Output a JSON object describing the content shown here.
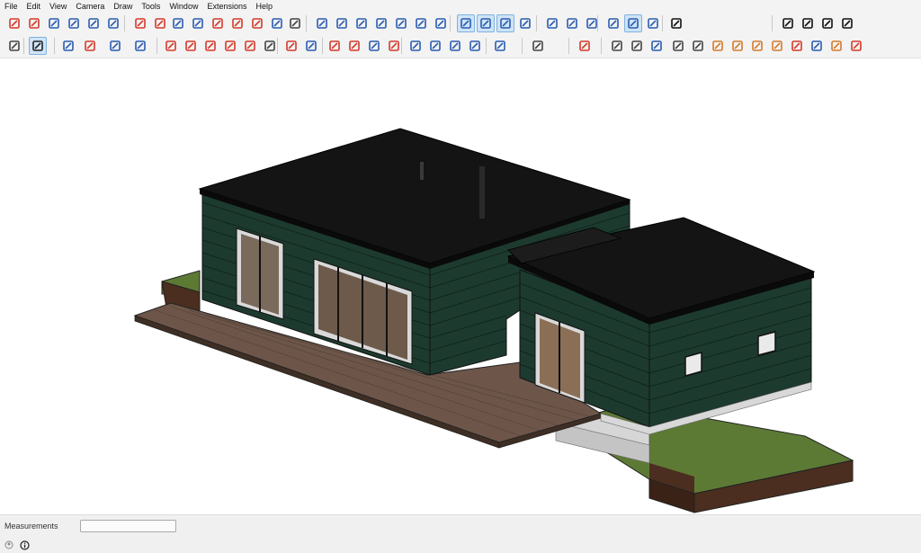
{
  "menu": [
    "File",
    "Edit",
    "View",
    "Camera",
    "Draw",
    "Tools",
    "Window",
    "Extensions",
    "Help"
  ],
  "toolbar_row1": [
    {
      "name": "section-plane-icon",
      "color": "#d43a2a"
    },
    {
      "name": "solid-tools-icon",
      "color": "#d43a2a"
    },
    {
      "name": "follow-me-icon",
      "color": "#2a5db0"
    },
    {
      "name": "text-icon",
      "color": "#2a5db0"
    },
    {
      "name": "axes-icon",
      "color": "#2a5db0"
    },
    {
      "name": "3d-text-icon",
      "color": "#2a5db0"
    },
    {
      "name": "orbit-icon",
      "color": "#d43a2a"
    },
    {
      "name": "pan-icon",
      "color": "#d43a2a"
    },
    {
      "name": "zoom-icon",
      "color": "#2a5db0"
    },
    {
      "name": "zoom-window-icon",
      "color": "#2a5db0"
    },
    {
      "name": "zoom-extents-icon",
      "color": "#d43a2a"
    },
    {
      "name": "previous-view-icon",
      "color": "#d43a2a"
    },
    {
      "name": "position-camera-icon",
      "color": "#d43a2a"
    },
    {
      "name": "look-around-icon",
      "color": "#2a5db0"
    },
    {
      "name": "walk-icon",
      "color": "#444444"
    },
    {
      "name": "iso-view-icon",
      "color": "#2a5db0"
    },
    {
      "name": "top-view-icon",
      "color": "#2a5db0"
    },
    {
      "name": "front-view-icon",
      "color": "#2a5db0"
    },
    {
      "name": "right-view-icon",
      "color": "#2a5db0"
    },
    {
      "name": "back-view-icon",
      "color": "#2a5db0"
    },
    {
      "name": "left-view-icon",
      "color": "#2a5db0"
    },
    {
      "name": "xray-icon",
      "color": "#2a5db0"
    },
    {
      "name": "back-edges-icon",
      "color": "#2a5db0",
      "active": true
    },
    {
      "name": "wireframe-icon",
      "color": "#2a5db0",
      "active": true
    },
    {
      "name": "hidden-line-icon",
      "color": "#2a5db0",
      "active": true
    },
    {
      "name": "shaded-icon",
      "color": "#2a5db0"
    },
    {
      "name": "shaded-textures-icon",
      "color": "#2a5db0"
    },
    {
      "name": "monochrome-icon",
      "color": "#2a5db0"
    },
    {
      "name": "display-edges-icon",
      "color": "#2a5db0"
    },
    {
      "name": "profiles-icon",
      "color": "#2a5db0"
    },
    {
      "name": "depth-cue-icon",
      "color": "#2a5db0",
      "active": true
    },
    {
      "name": "extensions-icon",
      "color": "#2a5db0"
    },
    {
      "name": "refresh-icon",
      "color": "#111111"
    },
    {
      "name": "sync-icon",
      "color": "#111111"
    },
    {
      "name": "plugin-icon",
      "color": "#111111"
    },
    {
      "name": "export-icon",
      "color": "#111111"
    },
    {
      "name": "report-icon",
      "color": "#111111"
    }
  ],
  "toolbar_row2": [
    {
      "name": "search-icon",
      "color": "#444444"
    },
    {
      "name": "select-icon",
      "color": "#222222",
      "active": true
    },
    {
      "name": "eraser-icon",
      "color": "#2a5db0"
    },
    {
      "name": "line-icon",
      "color": "#d43a2a"
    },
    {
      "name": "arc-icon",
      "color": "#2a5db0"
    },
    {
      "name": "rectangle-icon",
      "color": "#2a5db0"
    },
    {
      "name": "push-pull-icon",
      "color": "#d43a2a"
    },
    {
      "name": "offset-icon",
      "color": "#d43a2a"
    },
    {
      "name": "move-icon",
      "color": "#d43a2a"
    },
    {
      "name": "rotate-icon",
      "color": "#d43a2a"
    },
    {
      "name": "scale-icon",
      "color": "#d43a2a"
    },
    {
      "name": "tape-measure-icon",
      "color": "#444444"
    },
    {
      "name": "paint-bucket-icon",
      "color": "#d43a2a"
    },
    {
      "name": "component-icon",
      "color": "#2a5db0"
    },
    {
      "name": "orbit-2-icon",
      "color": "#d43a2a"
    },
    {
      "name": "pan-2-icon",
      "color": "#d43a2a"
    },
    {
      "name": "zoom-2-icon",
      "color": "#2a5db0"
    },
    {
      "name": "zoom-extents-2-icon",
      "color": "#d43a2a"
    },
    {
      "name": "sandbox-icon",
      "color": "#2a5db0"
    },
    {
      "name": "smoove-icon",
      "color": "#2a5db0"
    },
    {
      "name": "stamp-icon",
      "color": "#2a5db0"
    },
    {
      "name": "drape-icon",
      "color": "#2a5db0"
    },
    {
      "name": "warehouse-icon",
      "color": "#2a5db0"
    },
    {
      "name": "new-file-icon",
      "color": "#444444"
    },
    {
      "name": "layout-icon",
      "color": "#d43a2a"
    },
    {
      "name": "pencil-icon",
      "color": "#444444"
    },
    {
      "name": "dimension-icon",
      "color": "#444444"
    },
    {
      "name": "extrude-icon",
      "color": "#2a5db0"
    },
    {
      "name": "follow-path-icon",
      "color": "#444444"
    },
    {
      "name": "array-icon",
      "color": "#444444"
    },
    {
      "name": "box-icon",
      "color": "#d47a2a"
    },
    {
      "name": "loft-icon",
      "color": "#d47a2a"
    },
    {
      "name": "fillet-icon",
      "color": "#d47a2a"
    },
    {
      "name": "bend-icon",
      "color": "#d47a2a"
    },
    {
      "name": "split-icon",
      "color": "#d43a2a"
    },
    {
      "name": "twist-icon",
      "color": "#2a5db0"
    },
    {
      "name": "frame-icon",
      "color": "#d47a2a"
    },
    {
      "name": "frame-pin-icon",
      "color": "#d43a2a"
    }
  ],
  "status": {
    "measurements_label": "Measurements",
    "measurements_value": ""
  },
  "colors": {
    "siding": "#1d3a2f",
    "roof": "#141414",
    "deck": "#6a5448",
    "grass": "#5d7a35",
    "soil": "#4b2e1f",
    "slab": "#cfcfcf"
  }
}
